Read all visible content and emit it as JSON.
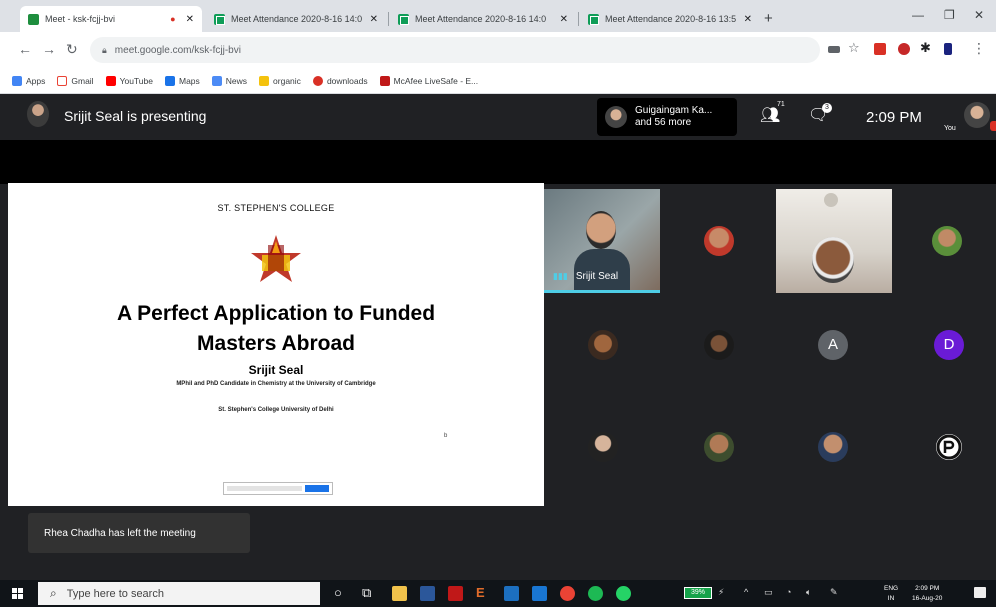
{
  "browser": {
    "tabs": [
      {
        "title": "Meet - ksk-fcjj-bvi",
        "favicon": "meet-icon",
        "active": true
      },
      {
        "title": "Meet Attendance 2020-8-16 14:0",
        "favicon": "sheets-icon",
        "active": false
      },
      {
        "title": "Meet Attendance 2020-8-16 14:0",
        "favicon": "sheets-icon",
        "active": false
      },
      {
        "title": "Meet Attendance 2020-8-16 13:5",
        "favicon": "sheets-icon",
        "active": false
      }
    ],
    "url": "meet.google.com/ksk-fcjj-bvi",
    "bookmarks": [
      "Apps",
      "Gmail",
      "YouTube",
      "Maps",
      "News",
      "organic",
      "downloads",
      "McAfee LiveSafe - E..."
    ]
  },
  "meet": {
    "presenting_label": "Srijit Seal is presenting",
    "participants_pill": {
      "line1": "Guigaingam Ka...",
      "line2": "and 56 more"
    },
    "people_count": "71",
    "chat_count": "3",
    "clock": "2:09 PM",
    "self_label": "You",
    "active_speaker": "Srijit Seal",
    "participant_letters": [
      "A",
      "D"
    ],
    "toast": "Rhea Chadha has left the meeting"
  },
  "slide": {
    "college": "ST. STEPHEN'S COLLEGE",
    "title_line1": "A Perfect Application to Funded",
    "title_line2": "Masters Abroad",
    "presenter": "Srijit Seal",
    "role": "MPhil and PhD Candidate in Chemistry at the University of Cambridge",
    "university": "St. Stephen's College University of Delhi",
    "mark": "b"
  },
  "taskbar": {
    "search_placeholder": "Type here to search",
    "battery": "39%",
    "lang_line1": "ENG",
    "lang_line2": "IN",
    "time": "2:09 PM",
    "date": "16-Aug-20"
  },
  "colors": {
    "meet_bg": "#202124",
    "speaking": "#4ecde6",
    "avatar_a": "#5f6368",
    "avatar_d": "#6a1bd6"
  }
}
